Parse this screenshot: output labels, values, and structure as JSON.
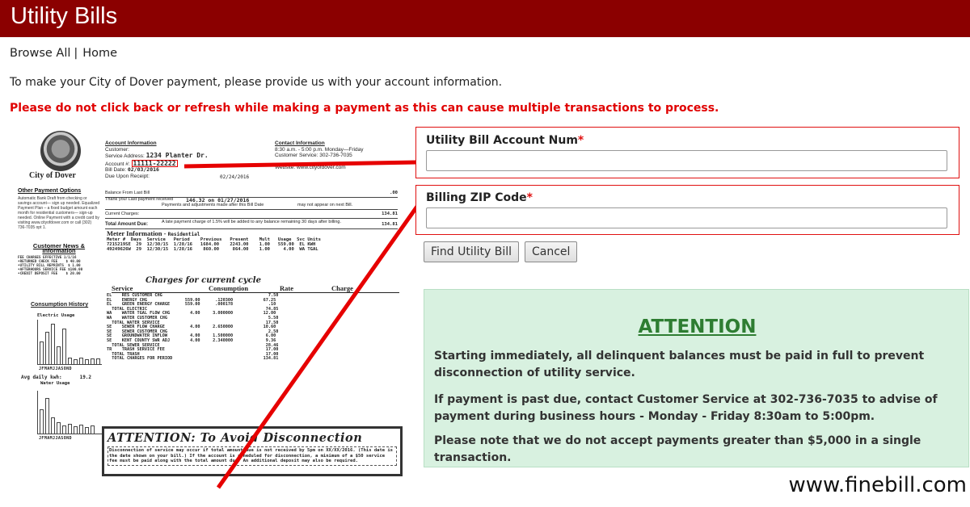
{
  "header": {
    "title": "Utility Bills"
  },
  "breadcrumb": {
    "browse_all": "Browse All",
    "separator": "|",
    "home": "Home"
  },
  "intro": "To make your City of Dover payment, please provide us with your account information.",
  "warning": "Please do not click back or refresh while making a payment as this can cause multiple transactions to process.",
  "bill": {
    "city_name": "City of Dover",
    "account_info_heading": "Account Information",
    "customer_label": "Customer:",
    "service_address_label": "Service Address:",
    "service_address": "1234 Planter Dr.",
    "account_label": "Account #:",
    "account_number": "11111-22222",
    "bill_date_label": "Bill Date:",
    "bill_date": "02/03/2016",
    "due_upon_receipt": "Due Upon Receipt:",
    "due_date": "02/24/2016",
    "contact_heading": "Contact Information",
    "contact_hours": "8:30 a.m. - 5:00 p.m. Monday—Friday",
    "contact_phone": "Customer Service: 302-736-7035",
    "contact_website": "Website: www.cityofdover.com",
    "other_options_heading": "Other Payment Options",
    "other_options_text": "Automatic Bank Draft from checking or savings account— sign up needed. Equalized Payment Plan – a fixed budget amount each month for residential customers— sign-up needed. Online Payment with a credit card by visiting www.cityofdover.com or call (302) 736-7035 opt 1.",
    "balance_prior_label": "Balance From Last Bill",
    "balance_prior_value": ".00",
    "payment_received_label": "Thank you! Last payment received",
    "payment_received_value": "146.32 on 01/27/2016",
    "payment_note": "Payments and adjustments made after this Bill Date",
    "payment_note_2": "may not appear on next Bill.",
    "current_charges_label": "Current Charges:",
    "current_charges_value": "134.81",
    "late_fee_note": "A late payment charge of 1.5% will be added to any balance remaining 30 days after billing.",
    "total_due_label": "Total Amount Due:",
    "total_due_value": "134.81",
    "news_heading": "Customer News & Information",
    "news_text": "FEE CHARGES EFFECTIVE 1/1/16\n•RETURNED CHECK FEE    $ 40.00\n•UTILITY BILL REPRINTS  $ 1.00\n•AFTERHOURS SERVICE FEE $100.00\n•CREDIT DEPOSIT FEE    $ 20.00",
    "meter_title": "Meter Information -",
    "meter_type": "Residential",
    "meter_table": "Meter #  Days  Service   Period    Previous   Present    Mult   Usage  Svc Units\n7215219SE  29  12/30/15  1/28/16   1684.00    2243.00    1.00   559.00  EL KWH\n49249626W  29  12/30/15  1/28/16    860.00     864.00    1.00     4.00  WA TGAL",
    "charges_title": "Charges for current cycle",
    "charges_head_service": "Service",
    "charges_head_consumption": "Consumption",
    "charges_head_rate": "Rate",
    "charges_head_charge": "Charge",
    "charges_body": "EL    RES CUSTOMER CHG                                          7.50\nEL    ENERGY CHG               559.00      .120300            67.25\nEL    GREEN ENERGY CHARGE      559.00      .000178              .10\n  TOTAL ELECTRIC                                               74.85\nWA    WATER TGAL FLOW CHG        4.00     3.000000            12.00\nWA    WATER CUSTOMER CHG                                        5.50\n  TOTAL WATER SERVICE                                          17.50\nSE    SEWER FLOW CHARGE          4.00     2.650000            10.60\nSE    SEWER CUSTOMER CHG                                        2.50\nSE    GROUNDWATER INFLOW         4.00     1.500000             6.00\nSE    KENT COUNTY SWR ADJ        4.00     2.340000             9.36\n  TOTAL SEWER SERVICE                                          28.46\nTR    TRASH SERVICE FEE                                        17.00\n  TOTAL TRASH                                                  17.00\n  TOTAL CHARGES FOR PERIOD                                    134.81",
    "consumption_heading": "Consumption History",
    "electric_usage": "Electric Usage",
    "water_usage": "Water Usage",
    "months": "JFMAMJJASOND",
    "avg_daily": "Avg daily kwh:",
    "avg_daily_value": "19.2",
    "avoid_title": "ATTENTION: To Avoid Disconnection",
    "avoid_text": "Disconnection of service may occur if total amount due is not received by 5pm on XX/XX/2016. (This date is the date shown on your bill.) If the account is scheduled for disconnection, a minimum of a $50 service fee must be paid along with the total amount due. An additional deposit may also be required."
  },
  "form": {
    "account_label": "Utility Bill Account Num",
    "zip_label": "Billing ZIP Code",
    "required_marker": "*",
    "account_value": "",
    "zip_value": "",
    "find_button": "Find Utility Bill",
    "cancel_button": "Cancel"
  },
  "attention": {
    "title": "ATTENTION",
    "p1": "Starting immediately, all delinquent balances must be paid in full to prevent disconnection of utility service.",
    "p2": "If payment is past due, contact Customer Service at 302-736-7035 to advise of payment during business hours - Monday - Friday 8:30am to 5:00pm.",
    "p3": "Please note that we do not accept payments greater than $5,000 in a single transaction."
  },
  "watermark": "www.finebill.com",
  "colors": {
    "header_bg": "#8b0000",
    "warning_text": "#e00000",
    "field_border": "#e01010",
    "attention_bg": "#d8f1e0",
    "attention_title": "#2e7d32"
  }
}
